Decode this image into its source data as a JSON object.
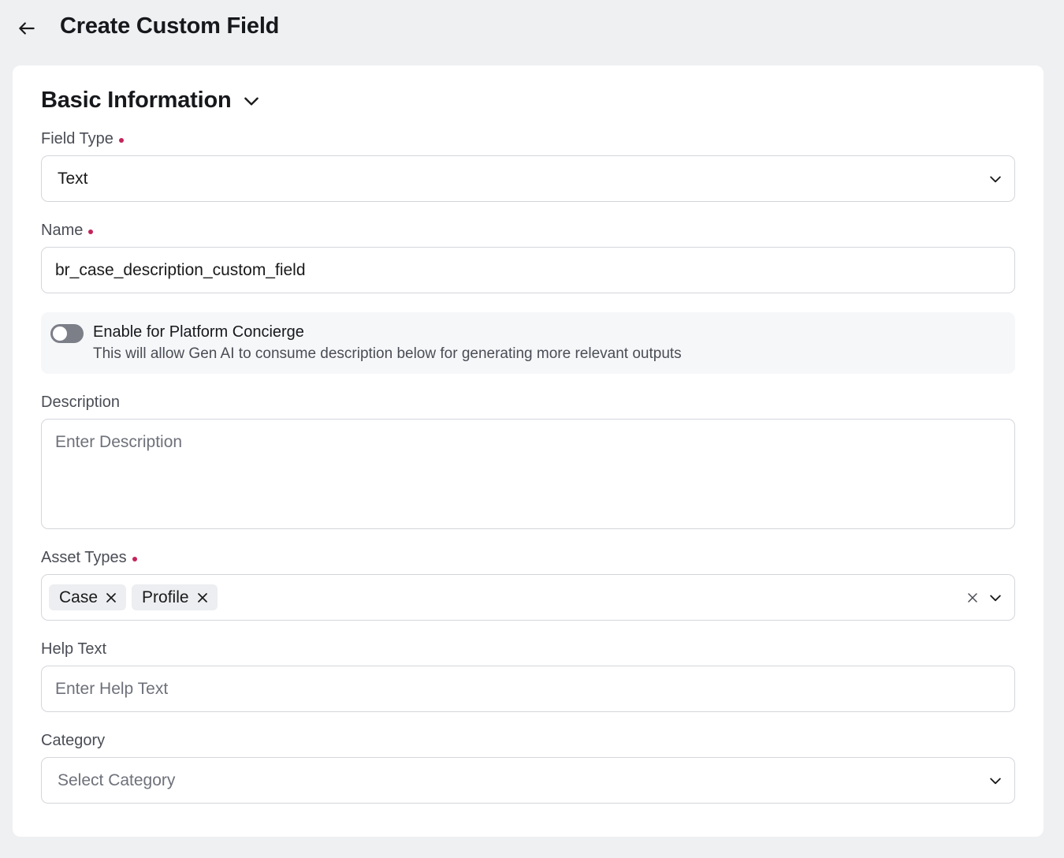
{
  "header": {
    "title": "Create Custom Field"
  },
  "section": {
    "title": "Basic Information"
  },
  "fields": {
    "field_type": {
      "label": "Field Type",
      "value": "Text",
      "required": true
    },
    "name": {
      "label": "Name",
      "value": "br_case_description_custom_field",
      "required": true
    },
    "concierge": {
      "title": "Enable for Platform Concierge",
      "description": "This will allow Gen AI to consume description below for generating more relevant outputs",
      "enabled": false
    },
    "description": {
      "label": "Description",
      "placeholder": "Enter Description"
    },
    "asset_types": {
      "label": "Asset Types",
      "required": true,
      "chips": [
        "Case",
        "Profile"
      ]
    },
    "help_text": {
      "label": "Help Text",
      "placeholder": "Enter Help Text"
    },
    "category": {
      "label": "Category",
      "placeholder": "Select Category"
    }
  },
  "colors": {
    "required": "#c4245a",
    "background": "#eff0f2",
    "toggle_off": "#7c7f88"
  },
  "icons": [
    "arrow-left-icon",
    "chevron-down-icon",
    "close-icon"
  ]
}
